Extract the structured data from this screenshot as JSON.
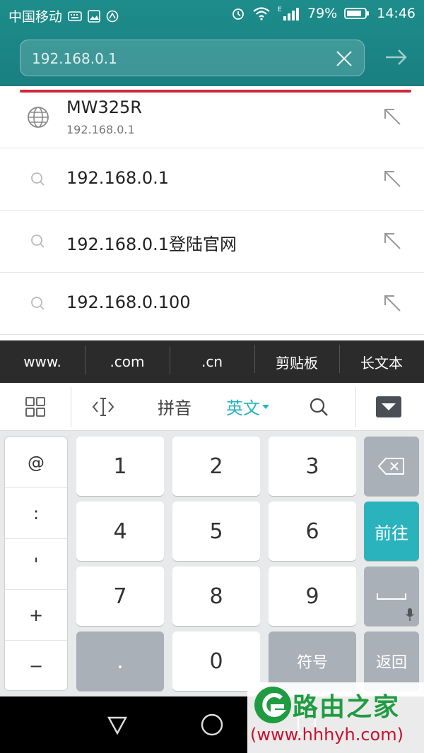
{
  "status_bar": {
    "carrier": "中国移动",
    "network_label": "E",
    "battery": "79%",
    "time": "14:46"
  },
  "url_bar": {
    "value": "192.168.0.1"
  },
  "suggestions": [
    {
      "title": "MW325R",
      "subtitle": "192.168.0.1",
      "icon": "globe-icon"
    },
    {
      "title": "192.168.0.1",
      "icon": "search-icon"
    },
    {
      "title": "192.168.0.1登陆官网",
      "icon": "search-icon"
    },
    {
      "title": "192.168.0.100",
      "icon": "search-icon"
    }
  ],
  "shortcuts": [
    "www.",
    ".com",
    ".cn",
    "剪贴板",
    "长文本"
  ],
  "toolbar": {
    "pinyin": "拼音",
    "english": "英文"
  },
  "keyboard": {
    "symbols": [
      "@",
      ":",
      "'",
      "+",
      "−"
    ],
    "digits": [
      "1",
      "2",
      "3",
      "4",
      "5",
      "6",
      "7",
      "8",
      "9"
    ],
    "dot": ".",
    "zero": "0",
    "symbol_key": "符号",
    "go_key": "前往",
    "return_key": "返回"
  },
  "watermark": {
    "brand": "路由之家",
    "url": "(www.hhhyh.com)"
  },
  "colors": {
    "header": "#1a8384",
    "progress": "#d1293a",
    "accent": "#2bb3bd"
  }
}
